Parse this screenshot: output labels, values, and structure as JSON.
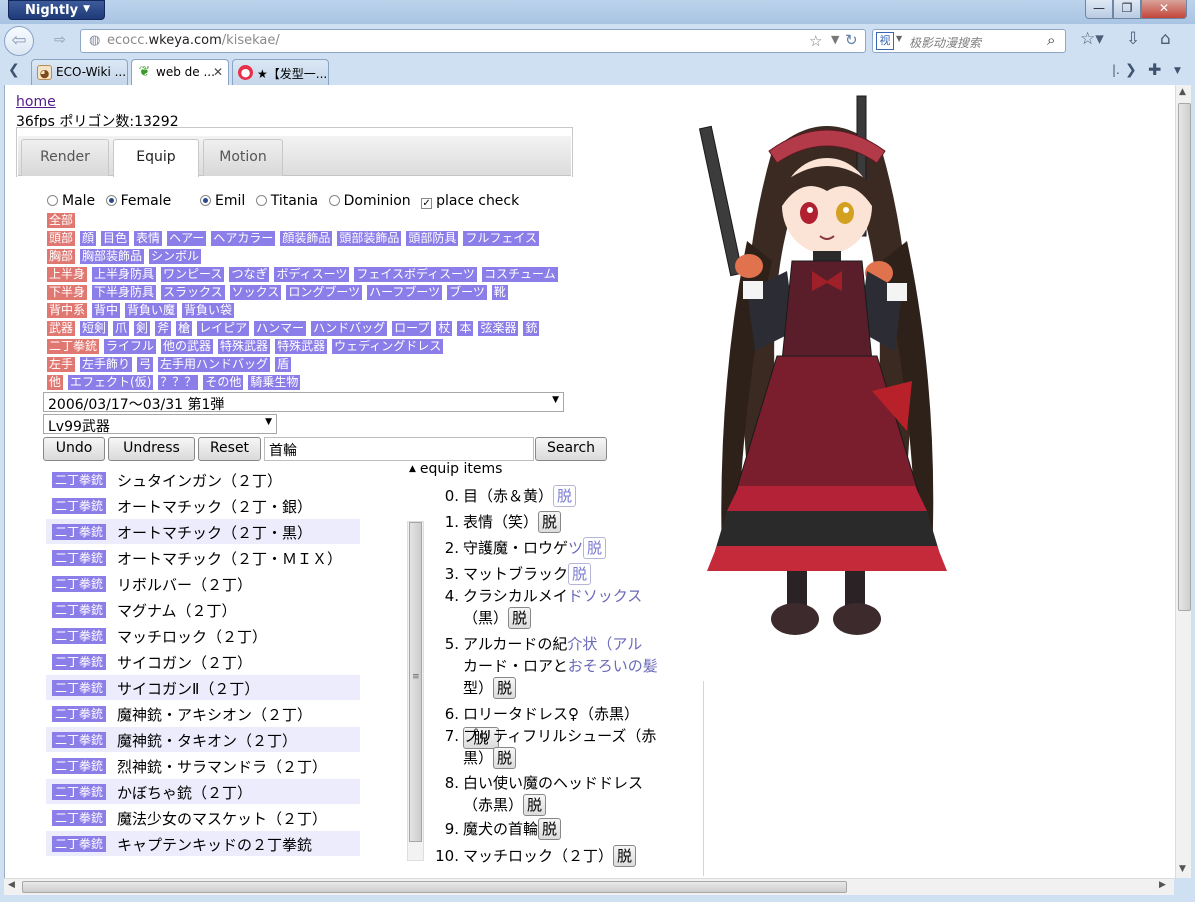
{
  "browser": {
    "app_button": "Nightly",
    "url_prefix": "ecocc.",
    "url_domain": "wkeya.com",
    "url_path": "/kisekae/",
    "search_engine_glyph": "视",
    "search_placeholder": "极影动漫搜索",
    "tabs": [
      {
        "label": "ECO-Wiki ..."
      },
      {
        "label": "web de ..."
      },
      {
        "label": "★【发型一..."
      }
    ]
  },
  "page": {
    "home_link": "home",
    "stats": "36fps ポリゴン数:13292",
    "ui_tabs": [
      "Render",
      "Equip",
      "Motion"
    ],
    "gender": {
      "male": "Male",
      "female": "Female"
    },
    "race": {
      "emil": "Emil",
      "titania": "Titania",
      "dominion": "Dominion"
    },
    "place_check": "place check",
    "categories": [
      [
        "全部"
      ],
      [
        "頭部",
        "顔",
        "目色",
        "表情",
        "ヘアー",
        "ヘアカラー",
        "顔装飾品",
        "頭部装飾品",
        "頭部防具",
        "フルフェイス"
      ],
      [
        "胸部",
        "胸部装飾品",
        "シンボル"
      ],
      [
        "上半身",
        "上半身防具",
        "ワンピース",
        "つなぎ",
        "ボディスーツ",
        "フェイスボディスーツ",
        "コスチューム"
      ],
      [
        "下半身",
        "下半身防具",
        "スラックス",
        "ソックス",
        "ロングブーツ",
        "ハーフブーツ",
        "ブーツ",
        "靴"
      ],
      [
        "背中系",
        "背中",
        "背負い魔",
        "背負い袋"
      ],
      [
        "武器",
        "短剣",
        "爪",
        "剣",
        "斧",
        "槍",
        "レイピア",
        "ハンマー",
        "ハンドバッグ",
        "ロープ",
        "杖",
        "本",
        "弦楽器",
        "銃"
      ],
      [
        "二丁拳銃",
        "ライフル",
        "他の武器",
        "特殊武器",
        "特殊武器",
        "ウェディングドレス"
      ],
      [
        "左手",
        "左手飾り",
        "弓",
        "左手用ハンドバッグ",
        "盾"
      ],
      [
        "他",
        "エフェクト(仮)",
        "？？？",
        "その他",
        "騎乗生物"
      ]
    ],
    "season_select": "2006/03/17～03/31 第1弾",
    "level_select": "Lv99武器",
    "buttons": {
      "undo": "Undo",
      "undress": "Undress",
      "reset": "Reset",
      "search": "Search"
    },
    "search_value": "首輪",
    "list_tag": "二丁拳銃",
    "list_items": [
      "シュタインガン（２丁）",
      "オートマチック（２丁・銀）",
      "オートマチック（２丁・黒）",
      "オートマチック（２丁・ＭＩＸ）",
      "リボルバー（２丁）",
      "マグナム（２丁）",
      "マッチロック（２丁）",
      "サイコガン（２丁）",
      "サイコガンⅡ（２丁）",
      "魔神銃・アキシオン（２丁）",
      "魔神銃・タキオン（２丁）",
      "烈神銃・サラマンドラ（２丁）",
      "かぼちゃ銃（２丁）",
      "魔法少女のマスケット（２丁）",
      "キャプテンキッドの２丁拳銃"
    ],
    "equip_heading": "equip items",
    "off_label": "脱",
    "equip": [
      {
        "n": "0.",
        "a": "目（赤＆黄）",
        "b": ""
      },
      {
        "n": "1.",
        "a": "表情（笑）",
        "b": ""
      },
      {
        "n": "2.",
        "a": "守護魔・ロウゲ",
        "b": "ツ"
      },
      {
        "n": "3.",
        "a": "マットブラック",
        "b": ""
      },
      {
        "n": "4.",
        "a": "クラシカルメイ",
        "b": "ドソックス"
      },
      {
        "n": "",
        "a": "（黒）",
        "b": ""
      },
      {
        "n": "5.",
        "a": "アルカードの紀",
        "b": "介状（アル"
      },
      {
        "n": "",
        "a": "カード・ロアと",
        "b": "おそろいの髪"
      },
      {
        "n": "",
        "a": "型）",
        "b": ""
      },
      {
        "n": "6.",
        "a": "ロリータドレス♀（赤黒）",
        "b": ""
      },
      {
        "n": "7.",
        "a": "プリティフリルシューズ（赤",
        "b": ""
      },
      {
        "n": "",
        "a": "黒）",
        "b": ""
      },
      {
        "n": "8.",
        "a": "白い使い魔のヘッドドレス",
        "b": ""
      },
      {
        "n": "",
        "a": "（赤黒）",
        "b": ""
      },
      {
        "n": "9.",
        "a": "魔犬の首輪",
        "b": ""
      },
      {
        "n": "10.",
        "a": "マッチロック（２丁）",
        "b": ""
      }
    ]
  }
}
